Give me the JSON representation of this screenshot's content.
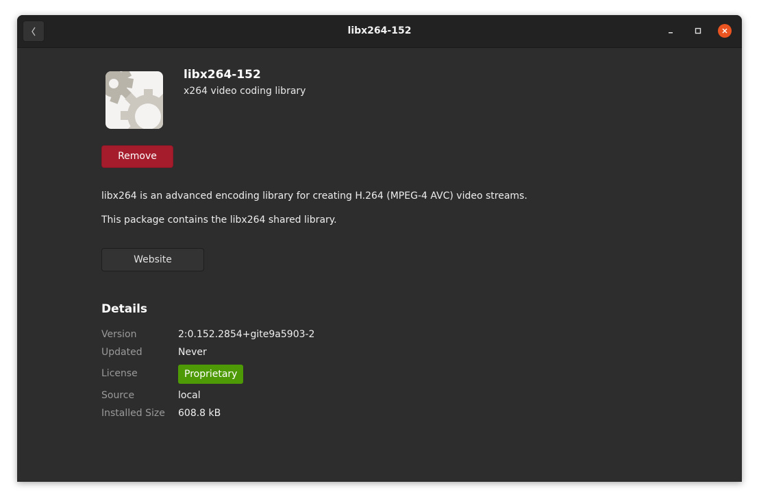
{
  "window": {
    "title": "libx264-152"
  },
  "app": {
    "icon": "gear-package-icon",
    "name": "libx264-152",
    "summary": "x264 video coding library",
    "remove_label": "Remove",
    "description": [
      "libx264 is an advanced encoding library for creating H.264 (MPEG-4 AVC) video streams.",
      "This package contains the libx264 shared library."
    ],
    "website_label": "Website"
  },
  "details": {
    "heading": "Details",
    "rows": [
      {
        "label": "Version",
        "value": "2:0.152.2854+gite9a5903-2"
      },
      {
        "label": "Updated",
        "value": "Never"
      },
      {
        "label": "License",
        "value": "Proprietary"
      },
      {
        "label": "Source",
        "value": "local"
      },
      {
        "label": "Installed Size",
        "value": "608.8 kB"
      }
    ]
  },
  "colors": {
    "remove_button": "#a51d2d",
    "license_badge": "#4e9a06",
    "close_button": "#e95420",
    "window_bg": "#2d2d2d",
    "titlebar_bg": "#222222"
  }
}
